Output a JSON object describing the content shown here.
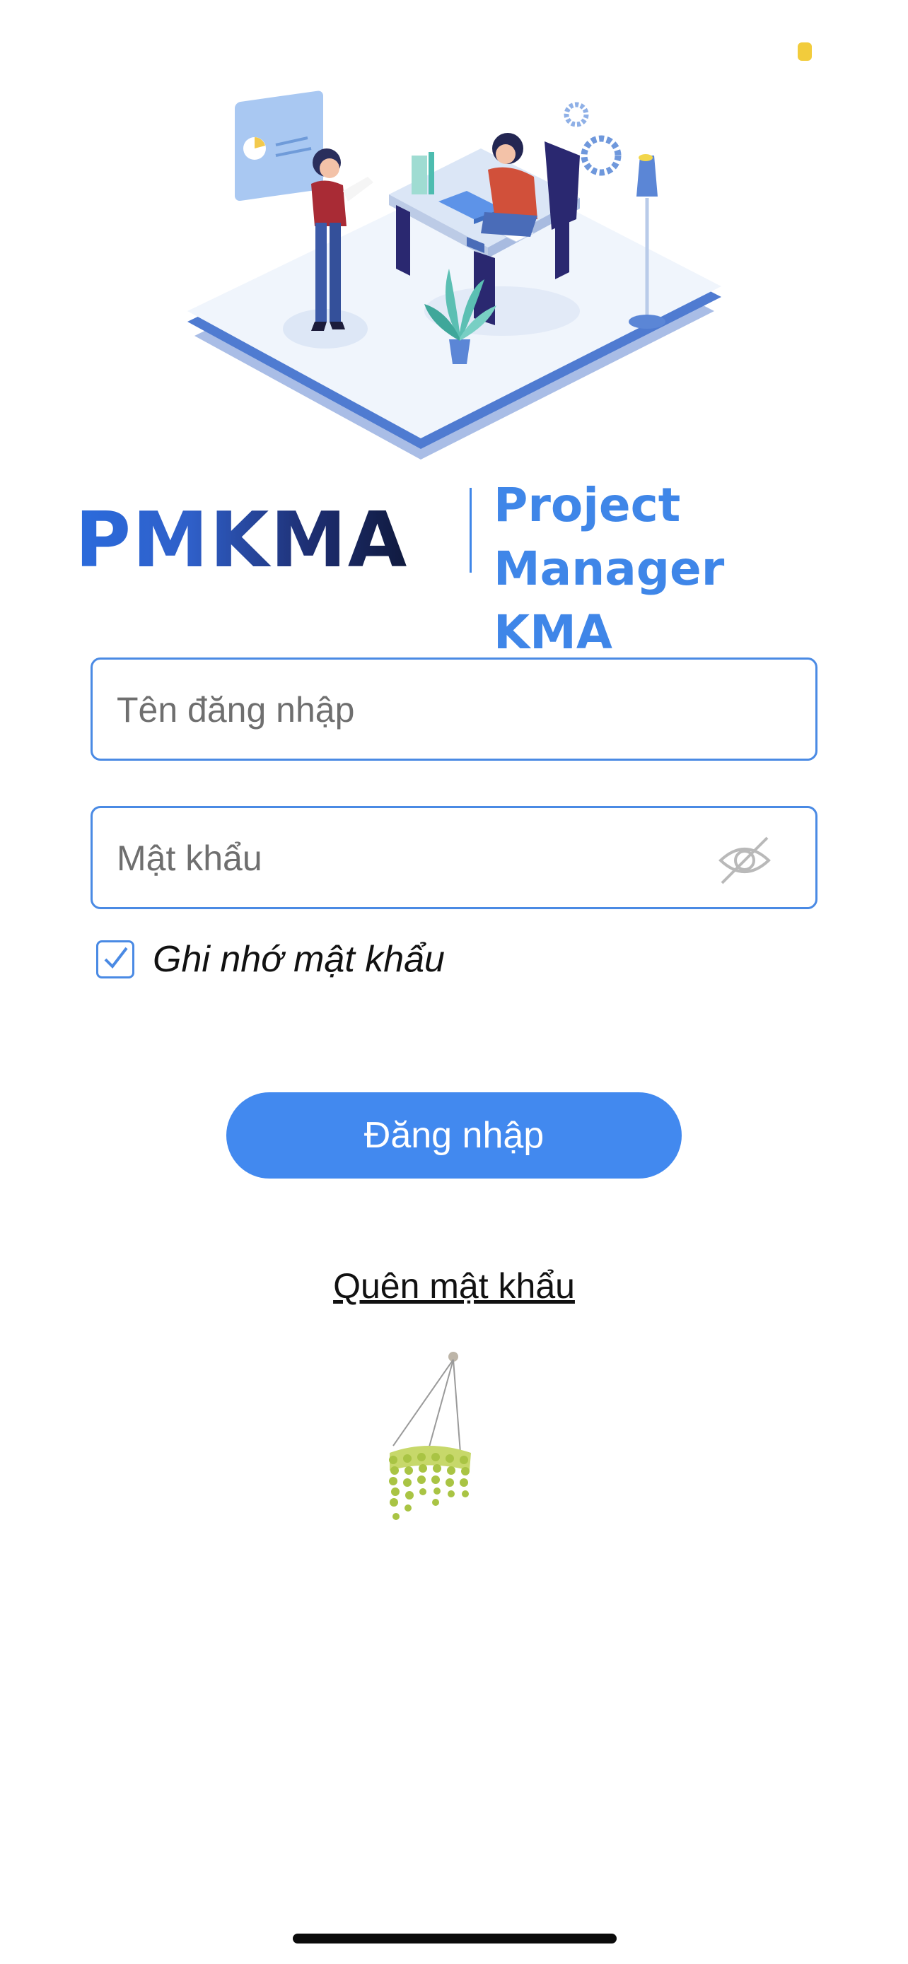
{
  "brand": {
    "logo": "PMKMA",
    "tagline_line1": "Project Manager",
    "tagline_line2": "KMA",
    "primary_color": "#3f86e8"
  },
  "form": {
    "username_placeholder": "Tên đăng nhập",
    "username_value": "",
    "password_placeholder": "Mật khẩu",
    "password_value": "",
    "password_visibility_icon": "eye-off-icon",
    "remember_label": "Ghi nhớ mật khẩu",
    "remember_checked": true,
    "login_label": "Đăng nhập",
    "forgot_label": "Quên mật khẩu",
    "button_color": "#4289ef"
  },
  "icons": {
    "status": "status-indicator-icon",
    "hero": "office-illustration",
    "plant": "hanging-plant-illustration"
  }
}
